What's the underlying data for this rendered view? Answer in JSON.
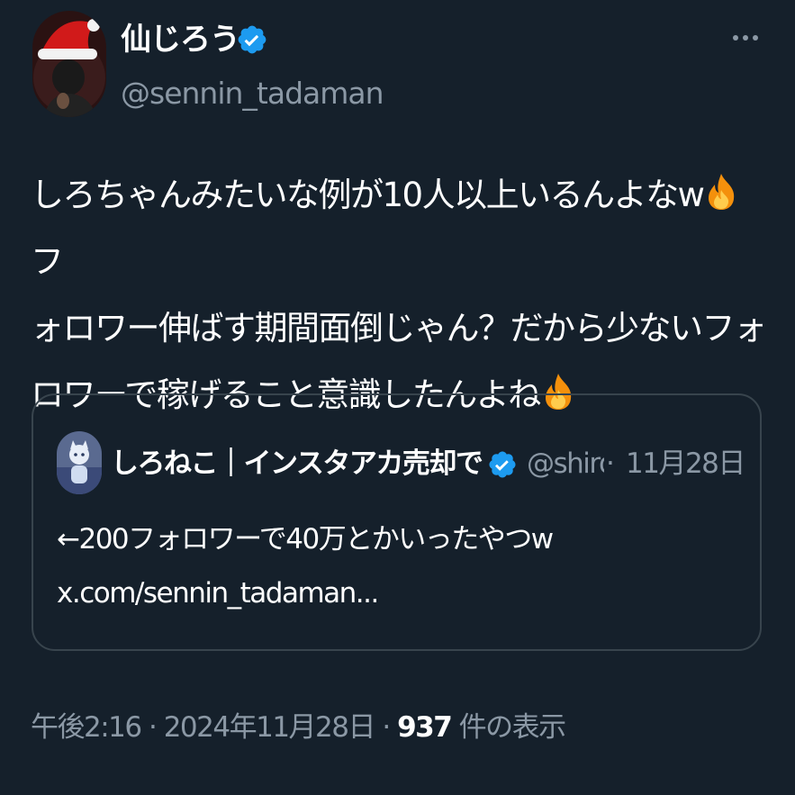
{
  "author": {
    "display_name": "仙じろう",
    "handle": "@sennin_tadaman",
    "verified": true
  },
  "tweet": {
    "text_lines": [
      "しろちゃんみたいな例が10人以上いるんよなw",
      "フ",
      "ォロワー伸ばす期間面倒じゃん？だから少ないフォ",
      "ロワーで稼げること意識したんよね"
    ],
    "emoji": "fire"
  },
  "quote": {
    "display_name": "しろねこ｜インスタアカ売却で",
    "handle": "@shiro",
    "separator": "·",
    "date": "11月28日",
    "verified": true,
    "text_line1": "←200フォロワーで40万とかいったやつw",
    "text_line2": "x.com/sennin_tadaman..."
  },
  "meta": {
    "time": "午後2:16",
    "sep1": "·",
    "date": "2024年11月28日",
    "sep2": "·",
    "views": "937",
    "views_label": "件の表示"
  },
  "icons": {
    "more": "more-dots-icon",
    "verified": "verified-badge-icon",
    "emoji": "fire-emoji-icon"
  },
  "colors": {
    "background": "#15202b",
    "secondary_text": "#8b98a5",
    "verified_blue": "#1d9bf0",
    "border": "#38444d"
  }
}
